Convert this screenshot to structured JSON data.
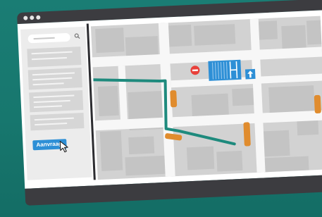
{
  "window": {
    "controls": [
      "close",
      "minimize",
      "maximize"
    ]
  },
  "sidebar": {
    "search": {
      "placeholder": "",
      "icon": "search-icon"
    },
    "request_button": {
      "label": "Aanvraag"
    }
  },
  "map": {
    "icons": [
      "no-entry-icon",
      "parking-icon",
      "one-way-icon"
    ],
    "route_color": "#1e8a7d",
    "car_color": "#e08c2e"
  },
  "colors": {
    "background": "#1a7d74",
    "accent": "#2d8fd6",
    "frame": "#3c3c40"
  }
}
